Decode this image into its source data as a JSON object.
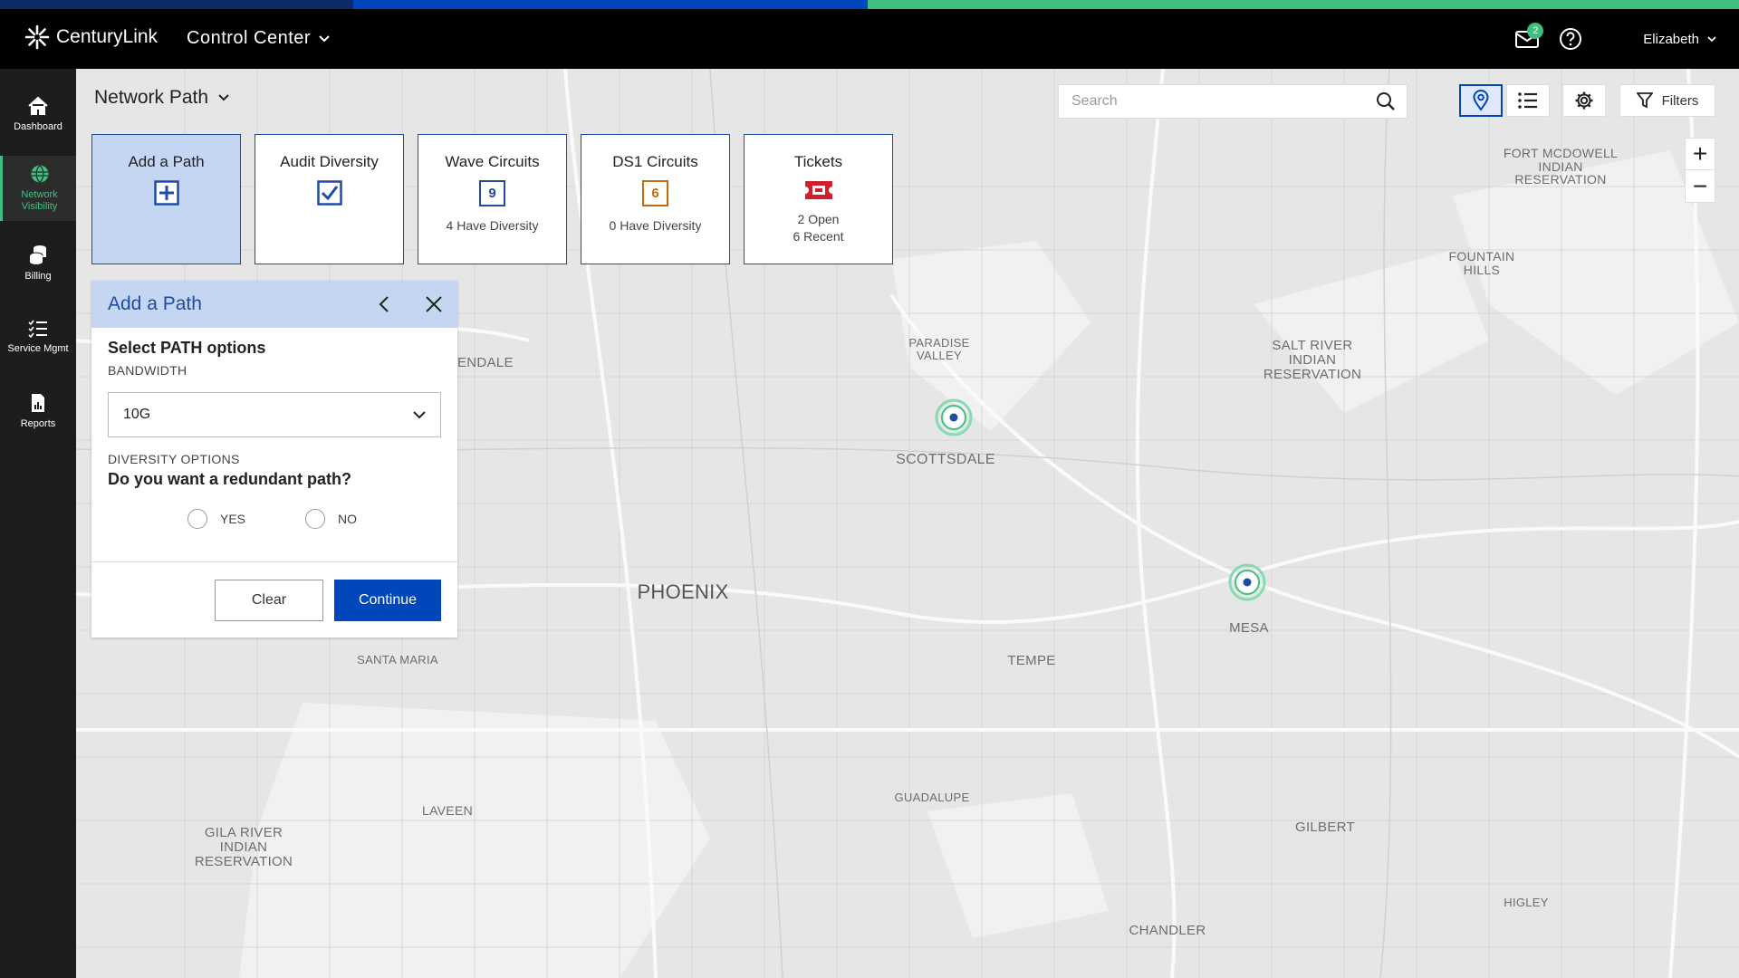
{
  "header": {
    "brand": "CenturyLink",
    "app_name": "Control Center",
    "mail_badge": "2",
    "user_name": "Elizabeth",
    "stripe_colors": [
      "#0c2a66",
      "#0047bb",
      "#3fc080"
    ]
  },
  "sidebar": {
    "items": [
      {
        "label": "Dashboard",
        "icon": "home-icon"
      },
      {
        "label": "Network Visibility",
        "icon": "globe-icon"
      },
      {
        "label": "Billing",
        "icon": "coins-icon"
      },
      {
        "label": "Service Mgmt",
        "icon": "checklist-icon"
      },
      {
        "label": "Reports",
        "icon": "report-icon"
      }
    ],
    "active": "Network Visibility"
  },
  "page": {
    "title": "Network Path"
  },
  "tiles": [
    {
      "title": "Add a Path",
      "icon": "plus-square-icon",
      "sub1": "",
      "sub2": ""
    },
    {
      "title": "Audit Diversity",
      "icon": "checkbox-icon",
      "sub1": "",
      "sub2": ""
    },
    {
      "title": "Wave Circuits",
      "count": "9",
      "sub1": "4 Have Diversity",
      "sub2": ""
    },
    {
      "title": "DS1 Circuits",
      "count": "6",
      "sub1": "0 Have Diversity",
      "sub2": ""
    },
    {
      "title": "Tickets",
      "icon": "ticket-icon",
      "sub1": "2 Open",
      "sub2": "6 Recent"
    }
  ],
  "panel": {
    "title": "Add a Path",
    "section_title": "Select PATH options",
    "bandwidth_label": "BANDWIDTH",
    "bandwidth_value": "10G",
    "diversity_label": "DIVERSITY OPTIONS",
    "question": "Do you want a redundant path?",
    "yes_label": "YES",
    "no_label": "NO",
    "clear_label": "Clear",
    "continue_label": "Continue"
  },
  "search": {
    "placeholder": "Search"
  },
  "filters_label": "Filters",
  "zoom": {
    "in": "+",
    "out": "−"
  },
  "map_labels": {
    "fort_mcdowell": "FORT MCDOWELL INDIAN RESERVATION",
    "fountain_hills": "FOUNTAIN HILLS",
    "salt_river": "SALT RIVER INDIAN RESERVATION",
    "paradise_valley": "PARADISE VALLEY",
    "scottsdale": "SCOTTSDALE",
    "glendale_partial": "ENDALE",
    "phoenix": "PHOENIX",
    "tempe": "TEMPE",
    "mesa": "MESA",
    "santa_maria": "SANTA MARIA",
    "guadalupe": "GUADALUPE",
    "laveen": "LAVEEN",
    "gila_river": "GILA RIVER INDIAN RESERVATION",
    "gilbert": "GILBERT",
    "chandler": "CHANDLER",
    "higley": "HIGLEY"
  }
}
